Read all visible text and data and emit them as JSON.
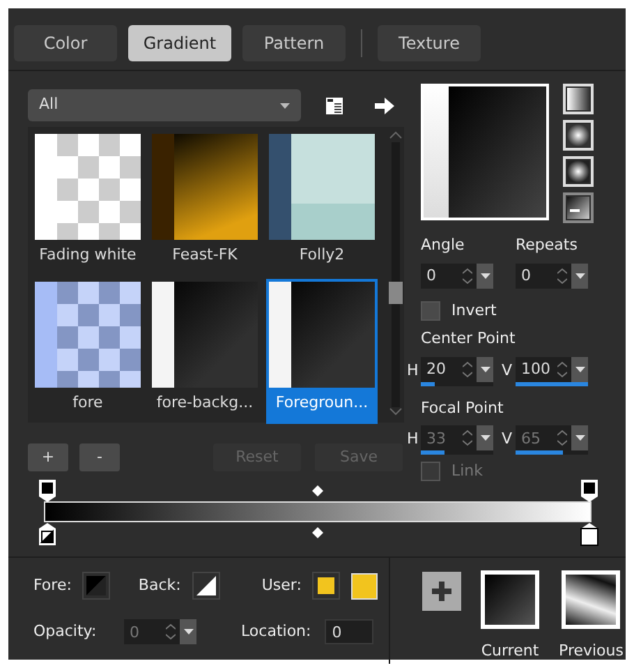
{
  "tabs": [
    {
      "label": "Color",
      "selected": false
    },
    {
      "label": "Gradient",
      "selected": true
    },
    {
      "label": "Pattern",
      "selected": false
    },
    {
      "label": "Texture",
      "selected": false
    }
  ],
  "library": {
    "category": "All",
    "gradients": [
      {
        "label": "Fading white",
        "kind": "checker",
        "color": "#ffffff",
        "selected": false
      },
      {
        "label": "Feast-FK",
        "kind": "dark-ramp",
        "color": "#e0a010",
        "selected": false
      },
      {
        "label": "Folly2",
        "kind": "split",
        "color": "#a8cfcb",
        "selected": false
      },
      {
        "label": "fore",
        "kind": "checker",
        "color": "#a6bcf6",
        "selected": false
      },
      {
        "label": "fore-backg...",
        "kind": "ramp",
        "color": "#303030",
        "selected": false
      },
      {
        "label": "Foregroun...",
        "kind": "ramp",
        "color": "#303030",
        "selected": true
      }
    ],
    "buttons": [
      {
        "label": "+",
        "disabled": false
      },
      {
        "label": "-",
        "disabled": false
      },
      {
        "label": "Reset",
        "disabled": true
      },
      {
        "label": "Save",
        "disabled": true
      }
    ]
  },
  "styles": [
    {
      "selected": false
    },
    {
      "selected": false
    },
    {
      "selected": false
    },
    {
      "selected": true
    }
  ],
  "angle": {
    "label": "Angle",
    "value": "0"
  },
  "repeats": {
    "label": "Repeats",
    "value": "0"
  },
  "invert": {
    "label": "Invert",
    "checked": false
  },
  "center_point": {
    "label": "Center Point",
    "h": {
      "label": "H",
      "value": "20",
      "level": 0.2,
      "disabled": false
    },
    "v": {
      "label": "V",
      "value": "100",
      "level": 1.0,
      "disabled": false
    }
  },
  "focal_point": {
    "label": "Focal Point",
    "h": {
      "label": "H",
      "value": "33",
      "level": 0.33,
      "disabled": true
    },
    "v": {
      "label": "V",
      "value": "65",
      "level": 0.65,
      "disabled": true
    }
  },
  "link": {
    "label": "Link",
    "checked": false,
    "disabled": true
  },
  "stops": {
    "fore": {
      "label": "Fore:"
    },
    "back": {
      "label": "Back:"
    },
    "user": {
      "label": "User:",
      "color": "#f2c41e"
    },
    "opacity": {
      "label": "Opacity:",
      "value": "0",
      "disabled": true
    },
    "location": {
      "label": "Location:",
      "value": "0"
    }
  },
  "current": {
    "label": "Current"
  },
  "previous": {
    "label": "Previous"
  }
}
